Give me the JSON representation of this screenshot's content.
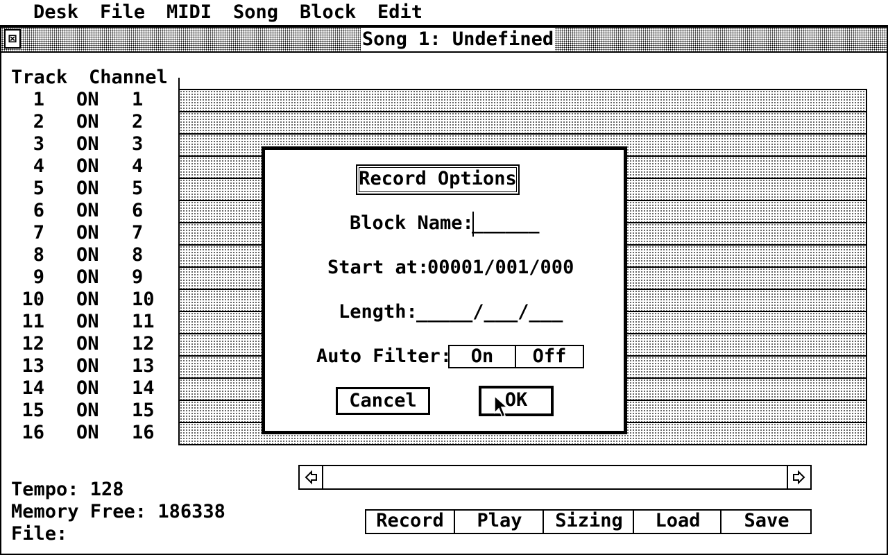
{
  "menu": [
    "Desk",
    "File",
    "MIDI",
    "Song",
    "Block",
    "Edit"
  ],
  "window": {
    "title": "Song 1: Undefined",
    "close_glyph": "⊠"
  },
  "track_header": {
    "track": "Track",
    "channel": "Channel"
  },
  "tracks": [
    {
      "num": "1",
      "state": "ON",
      "channel": "1"
    },
    {
      "num": "2",
      "state": "ON",
      "channel": "2"
    },
    {
      "num": "3",
      "state": "ON",
      "channel": "3"
    },
    {
      "num": "4",
      "state": "ON",
      "channel": "4"
    },
    {
      "num": "5",
      "state": "ON",
      "channel": "5"
    },
    {
      "num": "6",
      "state": "ON",
      "channel": "6"
    },
    {
      "num": "7",
      "state": "ON",
      "channel": "7"
    },
    {
      "num": "8",
      "state": "ON",
      "channel": "8"
    },
    {
      "num": "9",
      "state": "ON",
      "channel": "9"
    },
    {
      "num": "10",
      "state": "ON",
      "channel": "10"
    },
    {
      "num": "11",
      "state": "ON",
      "channel": "11"
    },
    {
      "num": "12",
      "state": "ON",
      "channel": "12"
    },
    {
      "num": "13",
      "state": "ON",
      "channel": "13"
    },
    {
      "num": "14",
      "state": "ON",
      "channel": "14"
    },
    {
      "num": "15",
      "state": "ON",
      "channel": "15"
    },
    {
      "num": "16",
      "state": "ON",
      "channel": "16"
    }
  ],
  "dialog": {
    "title": "Record Options",
    "block_name_label": "Block Name:",
    "block_name_value": "______",
    "start_label": "Start at:",
    "start_value": "00001/001/000",
    "length_label": "Length:",
    "length_value": "_____/___/___",
    "auto_filter_label": "Auto Filter:",
    "auto_filter_on": "On",
    "auto_filter_off": "Off",
    "cancel": "Cancel",
    "ok": "OK"
  },
  "status": {
    "tempo": "Tempo: 128",
    "memory": "Memory Free: 186338",
    "file": "File:"
  },
  "buttons": [
    "Record",
    "Play",
    "Sizing",
    "Load",
    "Save"
  ],
  "scroll": {
    "left_icon": "arrow-left-icon",
    "right_icon": "arrow-right-icon"
  }
}
